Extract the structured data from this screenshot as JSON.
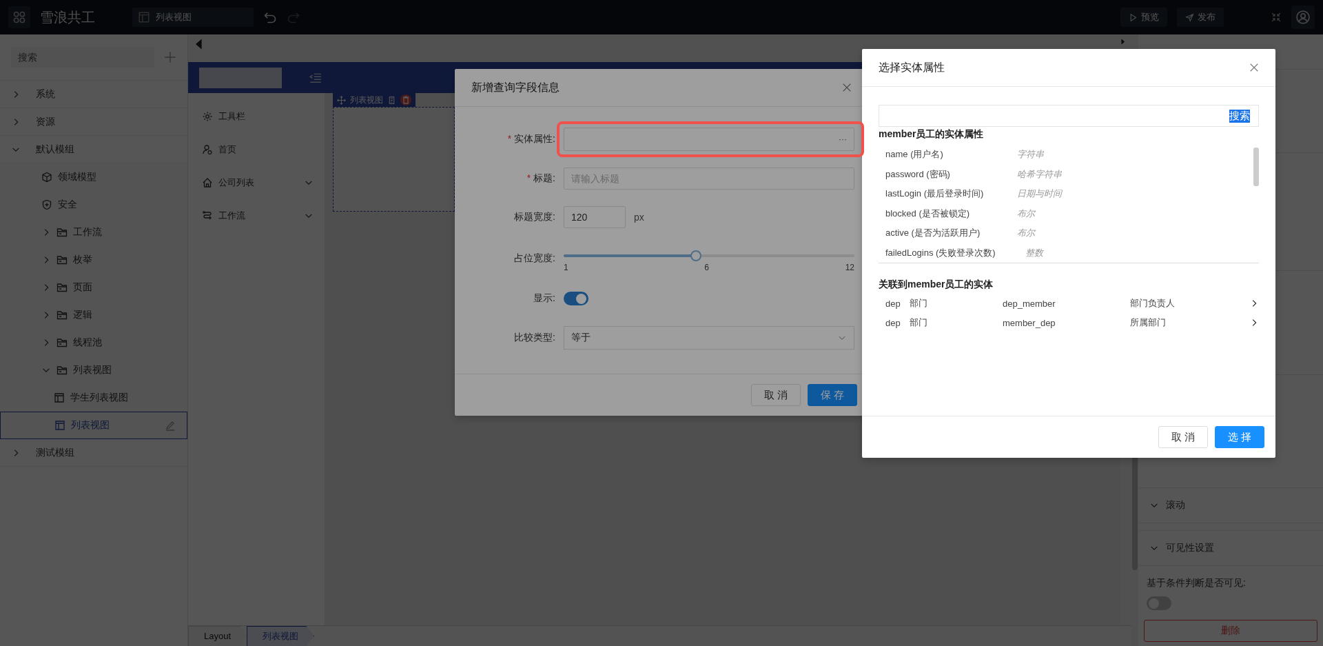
{
  "top_bar": {
    "app_title": "雪浪共工",
    "page_tab": "列表视图",
    "buttons": [
      {
        "label": "预览",
        "kind": "play"
      },
      {
        "label": "发布",
        "kind": "send"
      }
    ]
  },
  "sidebar": {
    "search_placeholder": "搜索",
    "tree": [
      {
        "label": "系统",
        "kind": "group",
        "expanded": false,
        "selected": false
      },
      {
        "label": "资源",
        "kind": "group",
        "expanded": false,
        "selected": false
      },
      {
        "label": "默认模组",
        "kind": "group",
        "expanded": true,
        "selected": false,
        "children": [
          {
            "label": "领域模型",
            "kind": "model",
            "selected": false
          },
          {
            "label": "安全",
            "kind": "security",
            "selected": false
          },
          {
            "label": "工作流",
            "kind": "folder",
            "expanded": false,
            "selected": false
          },
          {
            "label": "枚举",
            "kind": "folder",
            "expanded": false,
            "selected": false
          },
          {
            "label": "页面",
            "kind": "folder",
            "expanded": false,
            "selected": false
          },
          {
            "label": "逻辑",
            "kind": "folder",
            "expanded": false,
            "selected": false
          },
          {
            "label": "线程池",
            "kind": "folder",
            "expanded": false,
            "selected": false
          },
          {
            "label": "列表视图",
            "kind": "folder",
            "expanded": true,
            "selected": false,
            "children": [
              {
                "label": "学生列表视图",
                "kind": "view",
                "selected": false
              },
              {
                "label": "列表视图",
                "kind": "view",
                "selected": true
              }
            ]
          }
        ]
      },
      {
        "label": "测试模组",
        "kind": "group",
        "expanded": false,
        "selected": false
      }
    ]
  },
  "preview": {
    "menu": [
      {
        "label": "工具栏",
        "kind": "gear",
        "has_submenu": false
      },
      {
        "label": "首页",
        "kind": "user",
        "has_submenu": false
      },
      {
        "label": "公司列表",
        "kind": "home",
        "has_submenu": true
      },
      {
        "label": "工作流",
        "kind": "flow",
        "has_submenu": true
      }
    ],
    "component_tag": "列表视图"
  },
  "breadcrumb": [
    {
      "label": "Layout",
      "selected": false
    },
    {
      "label": "列表视图",
      "selected": true
    }
  ],
  "properties_panel": {
    "sections": [
      {
        "title": "滚动"
      },
      {
        "title": "可见性设置"
      }
    ],
    "visibility_label": "基于条件判断是否可见:",
    "visibility_on": false,
    "delete_button": "删除"
  },
  "query_dialog": {
    "title": "新增查询字段信息",
    "fields": [
      {
        "kind": "picker",
        "label": "实体属性:",
        "required_mark": "*",
        "button": "···",
        "highlighted": true
      },
      {
        "kind": "text",
        "label": "标题:",
        "required_mark": "*",
        "placeholder": "请输入标题"
      },
      {
        "kind": "number",
        "label": "标题宽度:",
        "value": "120",
        "unit": "px"
      },
      {
        "kind": "slider",
        "label": "占位宽度:",
        "level": 0.4545,
        "ticks": [
          "1",
          "6",
          "12"
        ]
      },
      {
        "kind": "switch",
        "label": "显示:",
        "on": true
      },
      {
        "kind": "select",
        "label": "比较类型:",
        "value": "等于"
      }
    ],
    "buttons": [
      {
        "label": "取 消",
        "primary": false
      },
      {
        "label": "保 存",
        "primary": true
      }
    ]
  },
  "entity_dialog": {
    "title": "选择实体属性",
    "search_button": "搜索",
    "search_button_selected": true,
    "attributes_heading": "member员工的实体属性",
    "attributes": [
      {
        "name": "name (用户名)",
        "type": "字符串"
      },
      {
        "name": "password (密码)",
        "type": "哈希字符串"
      },
      {
        "name": "lastLogin (最后登录时间)",
        "type": "日期与时间"
      },
      {
        "name": "blocked (是否被锁定)",
        "type": "布尔"
      },
      {
        "name": "active (是否为活跃用户)",
        "type": "布尔"
      },
      {
        "name": "failedLogins (失败登录次数)",
        "type": "整数"
      }
    ],
    "relations_heading": "关联到member员工的实体",
    "relations": [
      {
        "entity": "dep",
        "entity_label": "部门",
        "key": "dep_member",
        "role": "部门负责人"
      },
      {
        "entity": "dep",
        "entity_label": "部门",
        "key": "member_dep",
        "role": "所属部门"
      }
    ],
    "buttons": [
      {
        "label": "取 消",
        "primary": false
      },
      {
        "label": "选 择",
        "primary": true
      }
    ]
  }
}
